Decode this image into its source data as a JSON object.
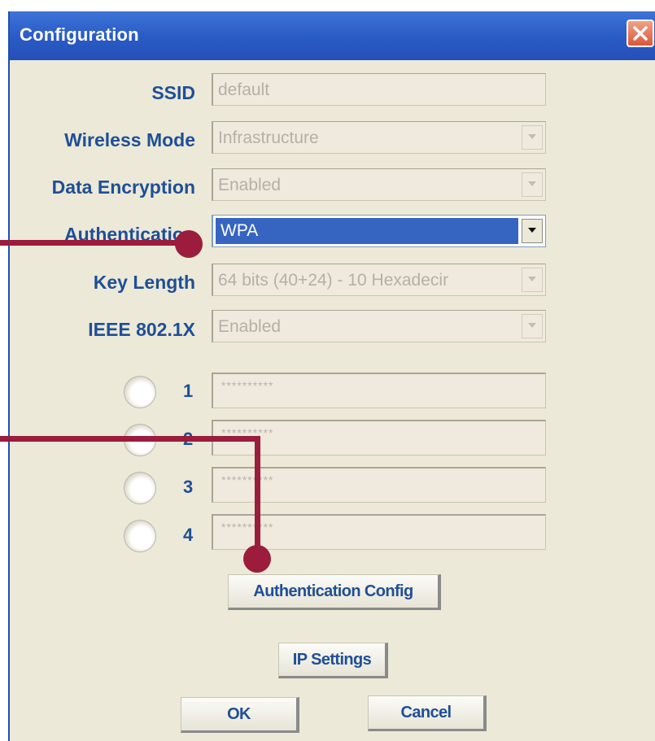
{
  "window": {
    "title": "Configuration"
  },
  "fields": {
    "ssid": {
      "label": "SSID",
      "value": "default"
    },
    "wireless_mode": {
      "label": "Wireless Mode",
      "value": "Infrastructure"
    },
    "data_encryption": {
      "label": "Data Encryption",
      "value": "Enabled"
    },
    "authentication": {
      "label": "Authentication",
      "value": "WPA"
    },
    "key_length": {
      "label": "Key Length",
      "value": "64 bits (40+24) - 10 Hexadecir"
    },
    "ieee8021x": {
      "label": "IEEE 802.1X",
      "value": "Enabled"
    }
  },
  "keys": [
    {
      "number": "1",
      "value": "**********"
    },
    {
      "number": "2",
      "value": "**********"
    },
    {
      "number": "3",
      "value": "**********"
    },
    {
      "number": "4",
      "value": "**********"
    }
  ],
  "buttons": {
    "auth_config": "Authentication Config",
    "ip_settings": "IP Settings",
    "ok": "OK",
    "cancel": "Cancel"
  },
  "icons": {
    "close": "close-icon",
    "dropdown": "chevron-down-icon"
  },
  "colors": {
    "titlebar": "#2a5ac4",
    "label": "#1f4f96",
    "selection": "#3665c1",
    "annotation": "#9b1c3d"
  }
}
